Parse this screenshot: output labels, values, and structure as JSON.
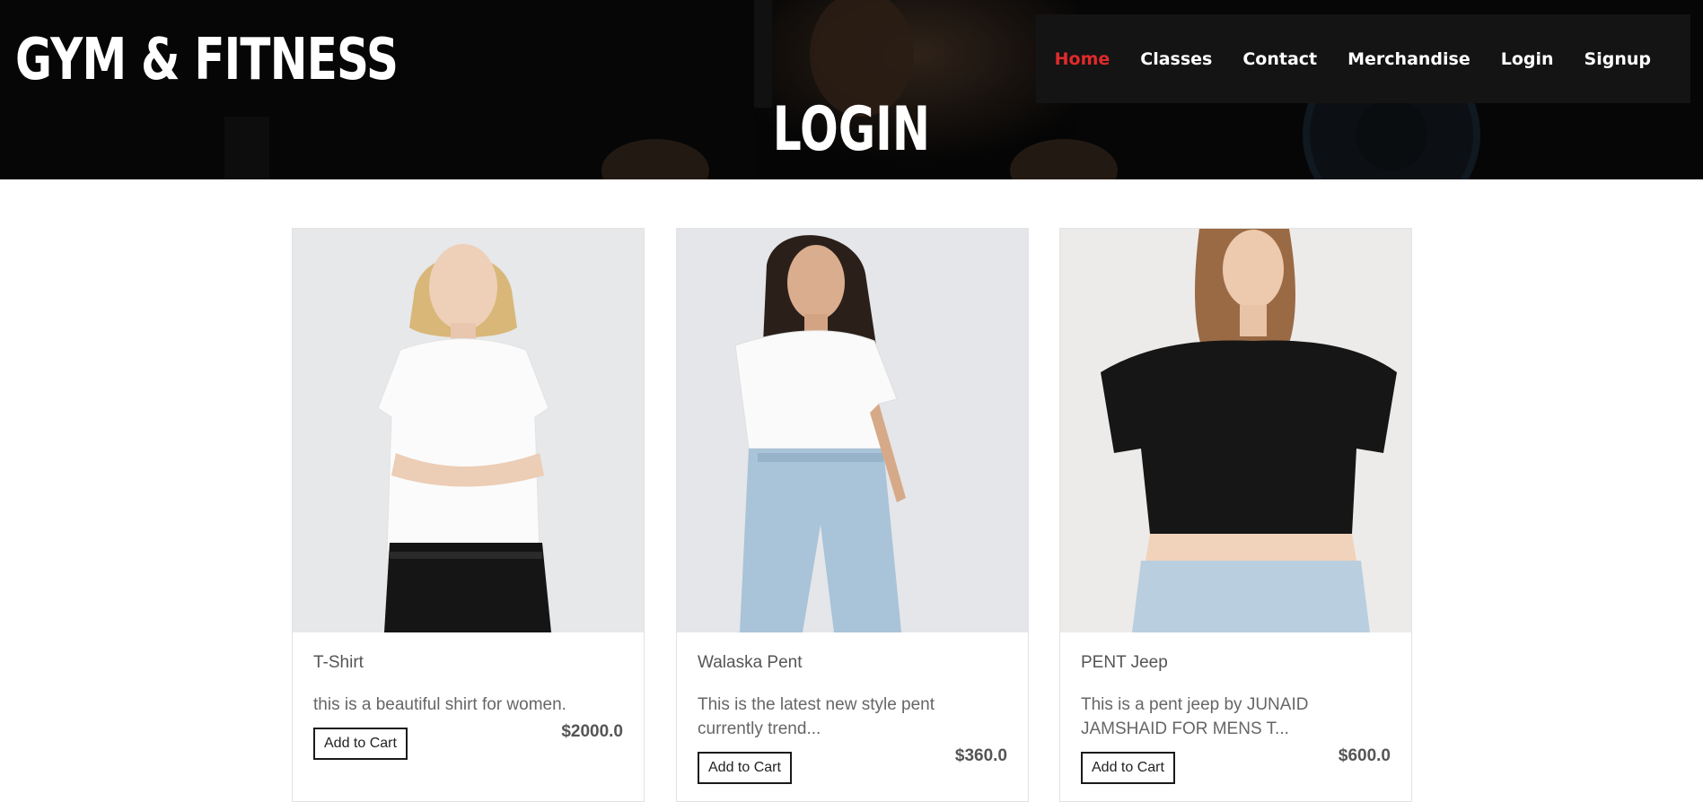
{
  "brand": {
    "logo_text": "GYM & FITNESS"
  },
  "nav": {
    "items": [
      {
        "label": "Home",
        "active": true
      },
      {
        "label": "Classes",
        "active": false
      },
      {
        "label": "Contact",
        "active": false
      },
      {
        "label": "Merchandise",
        "active": false
      },
      {
        "label": "Login",
        "active": false
      },
      {
        "label": "Signup",
        "active": false
      }
    ],
    "active_color": "#e02a2a"
  },
  "hero": {
    "title": "LOGIN"
  },
  "products": [
    {
      "name": "T-Shirt",
      "description": "this is a beautiful shirt for women.",
      "price": "$2000.0",
      "button_label": "Add to Cart",
      "image_icon": "woman-white-tshirt-black-jeans-photo"
    },
    {
      "name": "Walaska Pent",
      "description": "This is the latest new style pent currently trend...",
      "price": "$360.0",
      "button_label": "Add to Cart",
      "image_icon": "woman-white-tshirt-blue-jeans-photo"
    },
    {
      "name": "PENT Jeep",
      "description": "This is a pent jeep by JUNAID JAMSHAID FOR MENS T...",
      "price": "$600.0",
      "button_label": "Add to Cart",
      "image_icon": "woman-black-crop-top-denim-shorts-photo"
    }
  ]
}
